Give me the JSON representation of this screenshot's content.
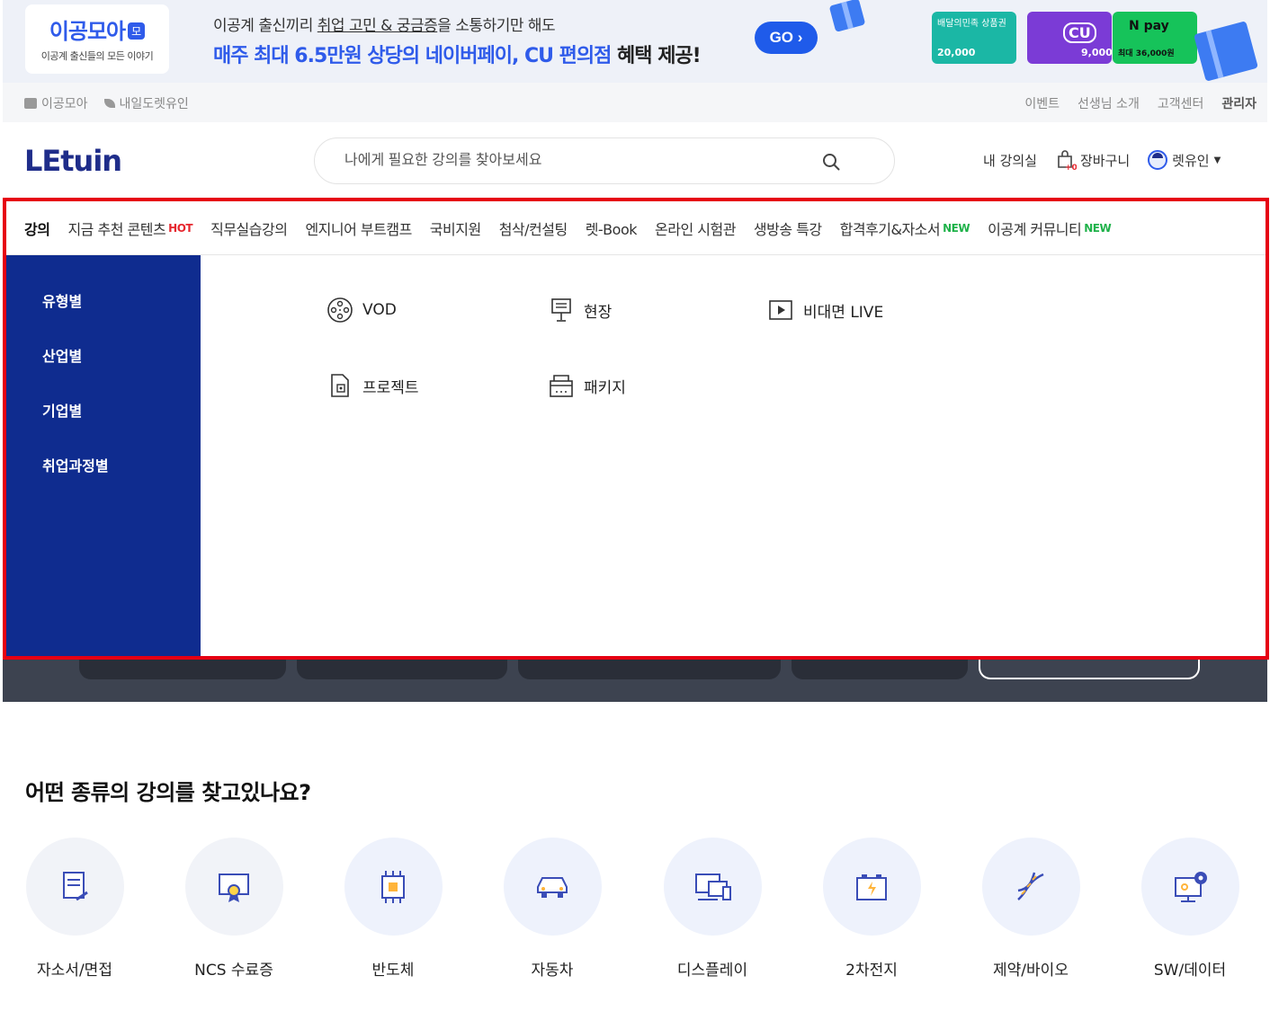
{
  "banner": {
    "logo_title": "이공모아",
    "logo_badge": "모",
    "logo_sub": "이공계 출신들의 모든 이야기",
    "line1_pre": "이공계 출신끼리 ",
    "line1_u": "취업 고민 & 궁금증",
    "line1_post": "을 소통하기만 해도",
    "line2_blue": "매주 최대 6.5만원 상당의 네이버페이, CU 편의점",
    "line2_dark": " 혜택 제공!",
    "go_label": "GO ›",
    "card_a_text": "배달의민족 상품권",
    "card_a_amount": "20,000",
    "card_b_text": "CU",
    "card_b_amount": "9,000",
    "card_c_text": "N pay",
    "card_c_amount": "최대 36,000원"
  },
  "util": {
    "left": [
      "이공모아",
      "내일도렛유인"
    ],
    "right": [
      "이벤트",
      "선생님 소개",
      "고객센터"
    ],
    "admin": "관리자"
  },
  "header": {
    "logo": "LEtuin",
    "search_placeholder": "나에게 필요한 강의를 찾아보세요",
    "my_class": "내 강의실",
    "cart": "장바구니",
    "cart_count": "+0",
    "user": "렛유인"
  },
  "nav": {
    "items": [
      "강의",
      "지금 추천 콘텐츠",
      "직무실습강의",
      "엔지니어 부트캠프",
      "국비지원",
      "첨삭/컨설팅",
      "렛-Book",
      "온라인 시험관",
      "생방송 특강",
      "합격후기&자소서",
      "이공계 커뮤니티"
    ],
    "hot": "HOT",
    "new": "NEW"
  },
  "side": {
    "items": [
      "유형별",
      "산업별",
      "기업별",
      "취업과정별"
    ]
  },
  "sub": {
    "items": [
      "VOD",
      "현장",
      "비대면 LIVE",
      "프로젝트",
      "패키지"
    ]
  },
  "section": {
    "title": "어떤 종류의 강의를 찾고있나요?"
  },
  "categories": [
    "자소서/면접",
    "NCS 수료증",
    "반도체",
    "자동차",
    "디스플레이",
    "2차전지",
    "제약/바이오",
    "SW/데이터"
  ],
  "colors": {
    "brand_navy": "#1f2d8a",
    "side_blue": "#0f2c8f",
    "accent_blue": "#2f5bea",
    "hot_red": "#e6262e",
    "new_green": "#1fb24a",
    "highlight_red": "#e60012"
  }
}
